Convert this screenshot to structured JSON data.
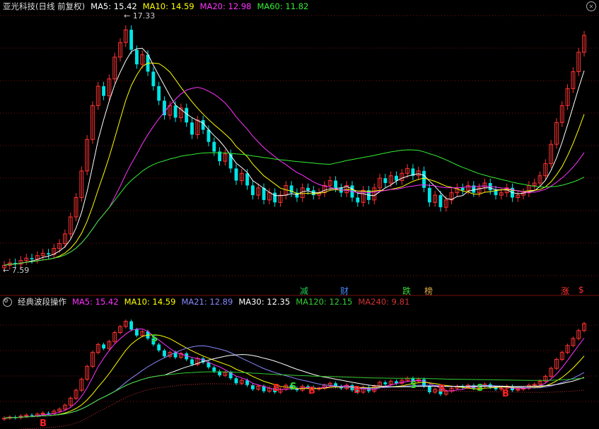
{
  "top_panel": {
    "title": "亚光科技(日线 前复权)",
    "ma": [
      {
        "label": "MA5: 15.42",
        "color": "#ffffff"
      },
      {
        "label": "MA10: 14.59",
        "color": "#ffff00"
      },
      {
        "label": "MA20: 12.98",
        "color": "#ff33ff"
      },
      {
        "label": "MA60: 11.82",
        "color": "#33ee33"
      }
    ],
    "price_high": "17.33",
    "price_low": "7.59"
  },
  "signals": [
    {
      "text": "减",
      "color": "#22cc55"
    },
    {
      "text": "财",
      "color": "#4488ff"
    },
    {
      "text": "跌",
      "color": "#33dd33"
    },
    {
      "text": "榜",
      "color": "#ddaa44"
    },
    {
      "text": "涨",
      "color": "#ff3333"
    },
    {
      "text": "$",
      "color": "#ff3333"
    }
  ],
  "bottom_panel": {
    "title": "经典波段操作",
    "ma": [
      {
        "label": "MA5: 15.42",
        "color": "#ff33ff"
      },
      {
        "label": "MA10: 14.59",
        "color": "#ffff00"
      },
      {
        "label": "MA21: 12.89",
        "color": "#8888ff"
      },
      {
        "label": "MA30: 12.35",
        "color": "#ffffff"
      },
      {
        "label": "MA120: 12.15",
        "color": "#33cc33"
      },
      {
        "label": "MA240: 9.81",
        "color": "#cc3333"
      }
    ],
    "marks": [
      {
        "text": "B",
        "color": "#ff2222"
      },
      {
        "text": "B",
        "color": "#ff2222"
      },
      {
        "text": "B",
        "color": "#ff2222"
      },
      {
        "text": "B",
        "color": "#ff2222"
      },
      {
        "text": "B",
        "color": "#ff2222"
      },
      {
        "text": "B",
        "color": "#ff2222"
      },
      {
        "text": "S",
        "color": "#33dd33"
      },
      {
        "text": "S",
        "color": "#33dd33"
      },
      {
        "text": "S",
        "color": "#33dd33"
      },
      {
        "text": "S",
        "color": "#33dd33"
      }
    ]
  },
  "colors": {
    "up": "#ff3333",
    "down": "#00e5e5",
    "grid": "#7a1010"
  },
  "chart_data": {
    "type": "candlestick",
    "closes": [
      7.6,
      7.7,
      7.65,
      7.8,
      7.9,
      7.85,
      8.0,
      8.1,
      8.05,
      8.3,
      8.5,
      8.9,
      9.6,
      10.4,
      11.5,
      12.8,
      14.2,
      15.0,
      14.6,
      15.3,
      16.2,
      16.8,
      17.33,
      16.5,
      15.9,
      16.3,
      15.6,
      15.0,
      14.4,
      13.8,
      14.2,
      13.7,
      14.1,
      13.5,
      13.0,
      13.6,
      13.2,
      12.7,
      12.3,
      11.9,
      12.2,
      11.6,
      11.1,
      11.4,
      10.9,
      10.5,
      10.8,
      10.3,
      10.6,
      10.2,
      10.5,
      10.9,
      10.6,
      10.4,
      10.8,
      10.7,
      10.5,
      10.6,
      10.9,
      11.1,
      10.8,
      10.6,
      10.9,
      10.4,
      10.2,
      10.7,
      10.3,
      10.8,
      11.2,
      11.0,
      11.3,
      11.1,
      11.4,
      11.6,
      11.3,
      11.5,
      10.8,
      10.2,
      10.5,
      10.0,
      10.3,
      10.6,
      10.8,
      10.7,
      10.9,
      10.6,
      10.8,
      11.0,
      10.7,
      10.5,
      10.6,
      10.8,
      10.4,
      10.5,
      10.6,
      10.9,
      11.0,
      11.3,
      11.8,
      12.6,
      13.5,
      14.2,
      14.9,
      15.6,
      16.4,
      17.1
    ]
  }
}
